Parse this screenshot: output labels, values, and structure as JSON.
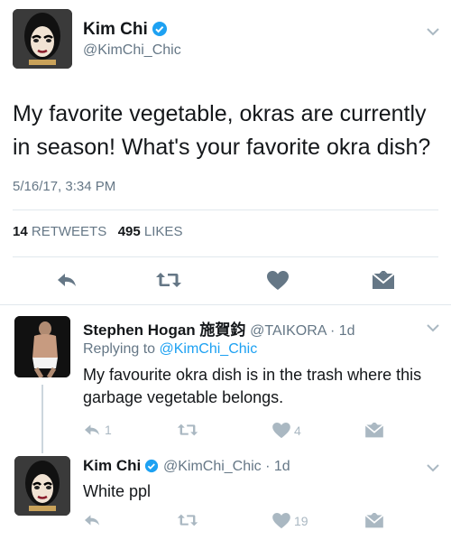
{
  "main_tweet": {
    "display_name": "Kim Chi",
    "handle": "@KimChi_Chic",
    "text": "My favorite vegetable, okras are currently in season! What's your favorite okra dish?",
    "timestamp": "5/16/17, 3:34 PM",
    "retweets_count": "14",
    "retweets_label": "RETWEETS",
    "likes_count": "495",
    "likes_label": "LIKES"
  },
  "replies": [
    {
      "display_name": "Stephen Hogan 施賀鈞",
      "handle_time": "@TAIKORA · 1d",
      "replying_prefix": "Replying to ",
      "replying_to": "@KimChi_Chic",
      "text": "My favourite okra dish is in the trash where this garbage vegetable belongs.",
      "reply_count": "1",
      "retweet_count": "",
      "like_count": "4"
    },
    {
      "display_name": "Kim Chi",
      "handle_time": "@KimChi_Chic · 1d",
      "text": "White ppl",
      "reply_count": "",
      "retweet_count": "",
      "like_count": "19"
    }
  ],
  "icons": {
    "verified": "verified-badge-icon",
    "chevron": "chevron-down-icon",
    "reply": "reply-icon",
    "retweet": "retweet-icon",
    "like": "heart-icon",
    "dm": "envelope-icon"
  },
  "colors": {
    "verified_blue": "#1da1f2",
    "action_main": "#657786",
    "action_light": "#aab8c2",
    "link_blue": "#1da1f2"
  }
}
